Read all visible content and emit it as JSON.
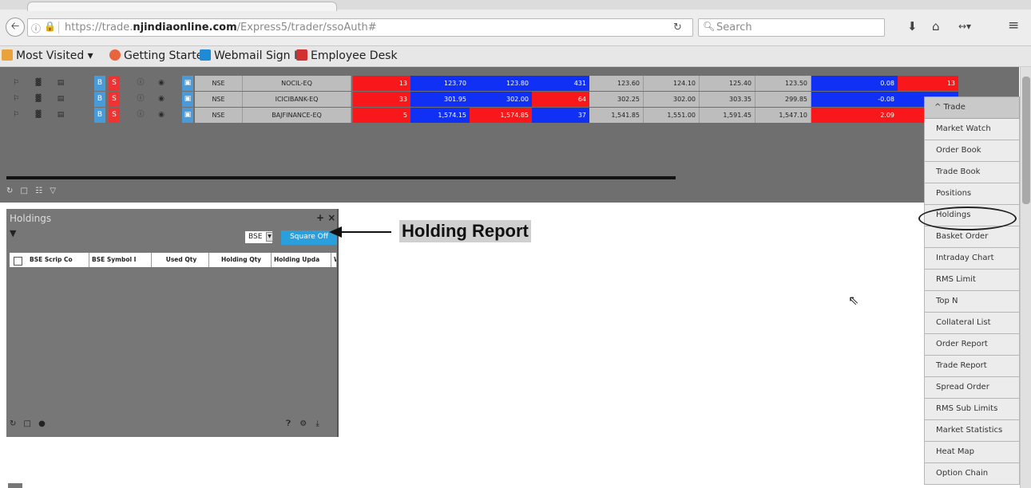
{
  "browser": {
    "url_prefix": "https://trade.",
    "url_domain": "njindiaonline.com",
    "url_path": "/Express5/trader/ssoAuth#",
    "search_placeholder": "Search",
    "icons": [
      "back-icon",
      "info-icon",
      "lock-icon",
      "reload-icon",
      "search-icon",
      "download-icon",
      "home-icon",
      "pocket-icon",
      "menu-icon"
    ]
  },
  "bookmarks": [
    {
      "label": "Most Visited ▾",
      "icon": "folder-icon",
      "color": "#e8a33c"
    },
    {
      "label": "Getting Started",
      "icon": "firefox-icon",
      "color": "#e8643c"
    },
    {
      "label": "Webmail Sign In",
      "icon": "webmail-icon",
      "color": "#1f8bd6"
    },
    {
      "label": "Employee Desk",
      "icon": "employee-icon",
      "color": "#d03030"
    }
  ],
  "market_watch": {
    "rows": [
      {
        "exchange": "NSE",
        "symbol": "NOCIL-EQ",
        "bid_qty": "13",
        "bid": "123.70",
        "ask": "123.80",
        "ask_qty": "431",
        "ltp": "123.60",
        "open": "124.10",
        "high": "125.40",
        "low": "123.50",
        "chg": "0.08",
        "vol": "13"
      },
      {
        "exchange": "NSE",
        "symbol": "ICICIBANK-EQ",
        "bid_qty": "33",
        "bid": "301.95",
        "ask": "302.00",
        "ask_qty": "64",
        "ltp": "302.25",
        "open": "302.00",
        "high": "303.35",
        "low": "299.85",
        "chg": "-0.08",
        "vol": ""
      },
      {
        "exchange": "NSE",
        "symbol": "BAJFINANCE-EQ",
        "bid_qty": "5",
        "bid": "1,574.15",
        "ask": "1,574.85",
        "ask_qty": "37",
        "ltp": "1,541.85",
        "open": "1,551.00",
        "high": "1,591.45",
        "low": "1,547.10",
        "chg": "2.09",
        "vol": ""
      }
    ],
    "button_b": "B",
    "button_s": "S",
    "colors": {
      "red": "#f8171b",
      "blue": "#1030f5",
      "gray": "#bdbdbd"
    }
  },
  "trade_menu": {
    "header": "^ Trade",
    "items": [
      "Market Watch",
      "Order Book",
      "Trade Book",
      "Positions",
      "Holdings",
      "Basket Order",
      "Intraday Chart",
      "RMS Limit",
      "Top N",
      "Collateral List",
      "Order Report",
      "Trade Report",
      "Spread Order",
      "RMS Sub Limits",
      "Market Statistics",
      "Heat Map",
      "Option Chain"
    ]
  },
  "holdings_panel": {
    "title": "Holdings",
    "tools": "+ ×",
    "exchange_select": "BSE",
    "square_off_label": "Square Off",
    "columns": [
      "BSE Scrip Co",
      "BSE Symbol I",
      "Used Qty",
      "Holding Qty",
      "Holding Upda",
      "W"
    ]
  },
  "annotation": {
    "label": "Holding Report"
  }
}
